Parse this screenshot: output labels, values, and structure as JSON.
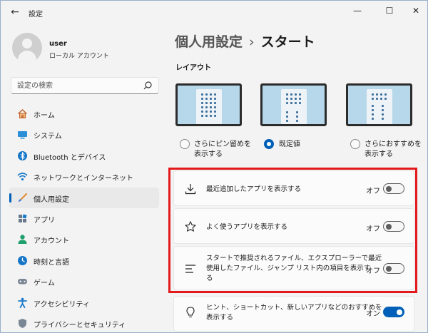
{
  "window": {
    "title": "設定",
    "back_glyph": "←",
    "minimize_glyph": "—",
    "maximize_glyph": "☐",
    "close_glyph": "✕"
  },
  "profile": {
    "name": "user",
    "account_type": "ローカル アカウント"
  },
  "search": {
    "placeholder": "設定の検索"
  },
  "sidebar": {
    "items": [
      {
        "label": "ホーム",
        "icon": "home-icon",
        "selected": false
      },
      {
        "label": "システム",
        "icon": "system-icon",
        "selected": false
      },
      {
        "label": "Bluetooth とデバイス",
        "icon": "bluetooth-icon",
        "selected": false
      },
      {
        "label": "ネットワークとインターネット",
        "icon": "network-icon",
        "selected": false
      },
      {
        "label": "個人用設定",
        "icon": "personalization-brush-icon",
        "selected": true
      },
      {
        "label": "アプリ",
        "icon": "apps-icon",
        "selected": false
      },
      {
        "label": "アカウント",
        "icon": "account-icon",
        "selected": false
      },
      {
        "label": "時刻と言語",
        "icon": "time-language-icon",
        "selected": false
      },
      {
        "label": "ゲーム",
        "icon": "gaming-icon",
        "selected": false
      },
      {
        "label": "アクセシビリティ",
        "icon": "accessibility-icon",
        "selected": false
      },
      {
        "label": "プライバシーとセキュリティ",
        "icon": "privacy-shield-icon",
        "selected": false
      }
    ]
  },
  "header": {
    "parent": "個人用設定",
    "separator": "›",
    "current": "スタート"
  },
  "layout": {
    "label": "レイアウト",
    "options": [
      {
        "line1": "さらにピン留めを",
        "line2": "表示する",
        "selected": false
      },
      {
        "line1": "既定値",
        "line2": "",
        "selected": true
      },
      {
        "line1": "さらにおすすめを",
        "line2": "表示する",
        "selected": false
      }
    ]
  },
  "settings": [
    {
      "label_lines": [
        "最近追加したアプリを表示する"
      ],
      "state": "オフ",
      "on": false,
      "icon": "download-icon"
    },
    {
      "label_lines": [
        "よく使うアプリを表示する"
      ],
      "state": "オフ",
      "on": false,
      "icon": "star-icon"
    },
    {
      "label_lines": [
        "スタートで推奨されるファイル、エクスプローラーで最近",
        "使用したファイル、ジャンプ リスト内の項目を表示す",
        "る"
      ],
      "state": "オフ",
      "on": false,
      "icon": "list-icon"
    },
    {
      "label_lines": [
        "ヒント、ショートカット、新しいアプリなどのおすすめを",
        "表示する"
      ],
      "state": "オン",
      "on": true,
      "icon": "lightbulb-icon"
    }
  ],
  "colors": {
    "accent": "#005fb8",
    "highlight": "#e3191b",
    "selected_nav_bg": "#e9e9e9"
  }
}
